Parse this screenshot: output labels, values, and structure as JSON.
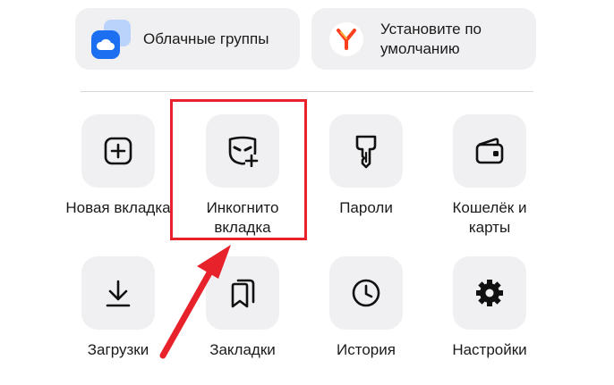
{
  "cards": {
    "cloud_groups": {
      "label": "Облачные группы",
      "icon": "cloud-icon"
    },
    "set_default": {
      "label": "Установите по умолчанию",
      "icon": "yandex-browser-icon"
    }
  },
  "grid": {
    "new_tab": {
      "label": "Новая вкладка",
      "icon": "plus-square-icon"
    },
    "incognito_tab": {
      "label": "Инкогнито вкладка",
      "icon": "incognito-mask-icon"
    },
    "passwords": {
      "label": "Пароли",
      "icon": "key-icon"
    },
    "wallet": {
      "label": "Кошелёк и карты",
      "icon": "wallet-icon"
    },
    "downloads": {
      "label": "Загрузки",
      "icon": "download-icon"
    },
    "bookmarks": {
      "label": "Закладки",
      "icon": "bookmarks-icon"
    },
    "history": {
      "label": "История",
      "icon": "clock-icon"
    },
    "settings": {
      "label": "Настройки",
      "icon": "gear-icon"
    }
  },
  "annotation": {
    "color": "#e8222b"
  },
  "colors": {
    "tile_bg": "#f0f0f2",
    "cloud_blue": "#1d6ff2",
    "yandex_red": "#fc3f1d"
  }
}
